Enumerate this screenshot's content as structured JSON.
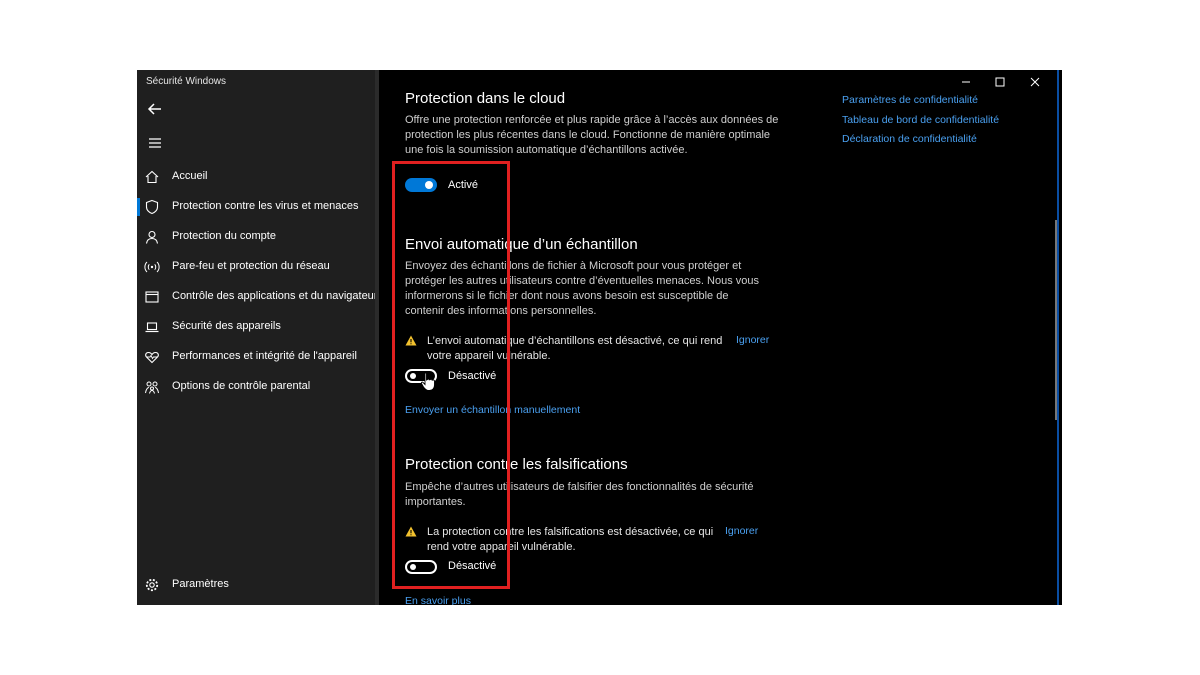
{
  "window": {
    "title": "Sécurité Windows"
  },
  "sidebar": {
    "items": [
      {
        "label": "Accueil",
        "icon": "home-icon"
      },
      {
        "label": "Protection contre les virus et menaces",
        "icon": "shield-icon",
        "active": true
      },
      {
        "label": "Protection du compte",
        "icon": "person-icon"
      },
      {
        "label": "Pare-feu et protection du réseau",
        "icon": "wifi-signal-icon"
      },
      {
        "label": "Contrôle des applications et du navigateur",
        "icon": "browser-window-icon"
      },
      {
        "label": "Sécurité des appareils",
        "icon": "laptop-icon"
      },
      {
        "label": "Performances et intégrité de l'appareil",
        "icon": "heart-icon"
      },
      {
        "label": "Options de contrôle parental",
        "icon": "family-icon"
      }
    ],
    "settings_label": "Paramètres"
  },
  "content": {
    "cloud": {
      "title": "Protection dans le cloud",
      "desc": "Offre une protection renforcée et plus rapide grâce à l’accès aux données de protection les plus récentes dans le cloud. Fonctionne de manière optimale une fois la soumission automatique d’échantillons activée.",
      "toggle_label": "Activé"
    },
    "sample": {
      "title": "Envoi automatique d’un échantillon",
      "desc": "Envoyez des échantillons de fichier à Microsoft pour vous protéger et protéger les autres utilisateurs contre d’éventuelles menaces. Nous vous informerons si le fichier dont nous avons besoin est susceptible de contenir des informations personnelles.",
      "warning": "L’envoi automatique d’échantillons est désactivé, ce qui rend votre appareil vulnérable.",
      "ignore_label": "Ignorer",
      "toggle_label": "Désactivé",
      "manual_link": "Envoyer un échantillon manuellement"
    },
    "tamper": {
      "title": "Protection contre les falsifications",
      "desc": "Empêche d’autres utilisateurs de falsifier des fonctionnalités de sécurité importantes.",
      "warning": "La protection contre les falsifications est désactivée, ce qui rend votre appareil vulnérable.",
      "ignore_label": "Ignorer",
      "toggle_label": "Désactivé",
      "learn_more": "En savoir plus"
    }
  },
  "privacy_links": [
    "Paramètres de confidentialité",
    "Tableau de bord de confidentialité",
    "Déclaration de confidentialité"
  ],
  "colors": {
    "accent": "#0078d7",
    "link": "#4aa0f0",
    "highlight": "#e02020",
    "warning": "#f2c12e"
  }
}
